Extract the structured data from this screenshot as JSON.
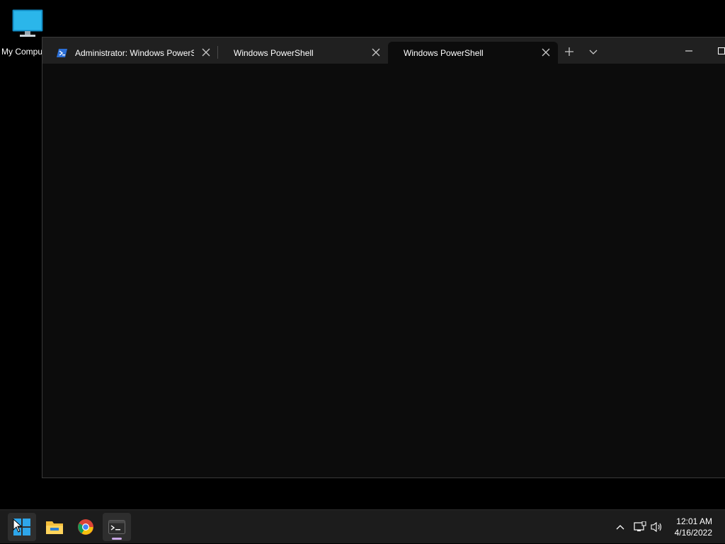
{
  "desktop": {
    "icons": [
      {
        "label": "My Compu",
        "icon": "monitor-icon"
      }
    ]
  },
  "terminal": {
    "tabs": [
      {
        "label": "Administrator: Windows PowerS",
        "icon": "powershell-icon",
        "active": false
      },
      {
        "label": "Windows PowerShell",
        "active": false
      },
      {
        "label": "Windows PowerShell",
        "active": true
      }
    ],
    "new_tab_icon": "plus-icon",
    "dropdown_icon": "chevron-down-icon",
    "window_controls": [
      "minimize-icon",
      "maximize-icon"
    ]
  },
  "taskbar": {
    "apps": [
      {
        "name": "Start",
        "icon": "windows-logo-icon"
      },
      {
        "name": "File Explorer",
        "icon": "folder-icon"
      },
      {
        "name": "Google Chrome",
        "icon": "chrome-icon"
      },
      {
        "name": "Terminal",
        "icon": "terminal-icon",
        "active": true
      }
    ],
    "tray_icons": [
      "chevron-up-icon",
      "network-icon",
      "volume-icon"
    ],
    "clock": {
      "time": "12:01 AM",
      "date": "4/16/2022"
    }
  },
  "colors": {
    "desktop_bg": "#000000",
    "titlebar_bg": "#202020",
    "terminal_bg": "#0c0c0c",
    "taskbar_bg": "#1c1c1c",
    "accent": "#c9a7e6"
  }
}
